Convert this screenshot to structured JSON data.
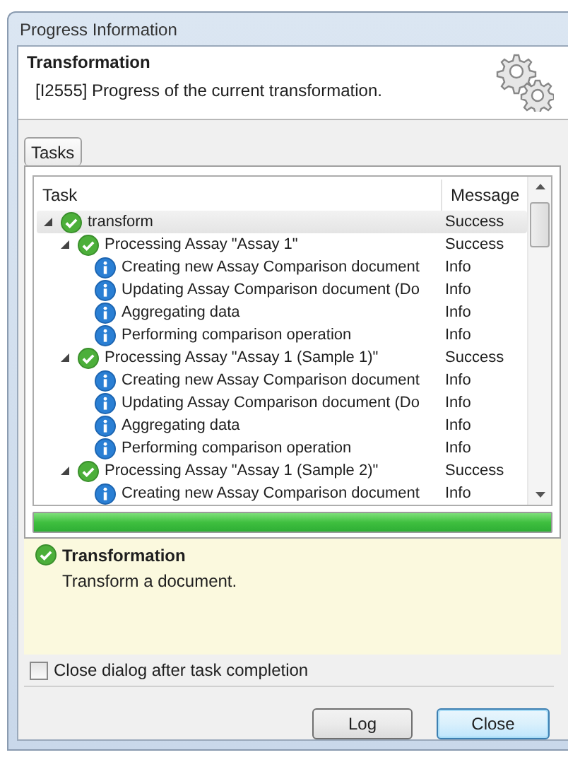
{
  "window": {
    "title": "Progress Information"
  },
  "header": {
    "title": "Transformation",
    "description": "[I2555] Progress of the current transformation."
  },
  "tabs": [
    {
      "label": "Tasks",
      "selected": true
    }
  ],
  "table": {
    "columns": [
      "Task",
      "Message"
    ],
    "rows": [
      {
        "kind": "success",
        "task": "transform",
        "message": "Success",
        "expanded": true,
        "selected": true,
        "children": [
          {
            "kind": "success",
            "task": "Processing Assay \"Assay 1\"",
            "message": "Success",
            "expanded": true,
            "selected": false,
            "children": [
              {
                "kind": "info",
                "task": "Creating new Assay Comparison document",
                "message": "Info",
                "selected": false
              },
              {
                "kind": "info",
                "task": "Updating Assay Comparison document (Do",
                "message": "Info",
                "selected": false
              },
              {
                "kind": "info",
                "task": "Aggregating data",
                "message": "Info",
                "selected": false
              },
              {
                "kind": "info",
                "task": "Performing comparison operation",
                "message": "Info",
                "selected": false
              }
            ]
          },
          {
            "kind": "success",
            "task": "Processing Assay \"Assay 1 (Sample 1)\"",
            "message": "Success",
            "expanded": true,
            "selected": false,
            "children": [
              {
                "kind": "info",
                "task": "Creating new Assay Comparison document",
                "message": "Info",
                "selected": false
              },
              {
                "kind": "info",
                "task": "Updating Assay Comparison document (Do",
                "message": "Info",
                "selected": false
              },
              {
                "kind": "info",
                "task": "Aggregating data",
                "message": "Info",
                "selected": false
              },
              {
                "kind": "info",
                "task": "Performing comparison operation",
                "message": "Info",
                "selected": false
              }
            ]
          },
          {
            "kind": "success",
            "task": "Processing Assay \"Assay 1 (Sample 2)\"",
            "message": "Success",
            "expanded": true,
            "selected": false,
            "children": [
              {
                "kind": "info",
                "task": "Creating new Assay Comparison document",
                "message": "Info",
                "selected": false
              }
            ]
          }
        ]
      }
    ]
  },
  "progress": {
    "level": 1
  },
  "details": {
    "kind": "success",
    "title": "Transformation",
    "description": "Transform a document."
  },
  "checkbox": {
    "label": "Close dialog after task completion",
    "checked": false
  },
  "buttons": [
    {
      "label": "Log",
      "default": false
    },
    {
      "label": "Close",
      "default": true
    }
  ]
}
